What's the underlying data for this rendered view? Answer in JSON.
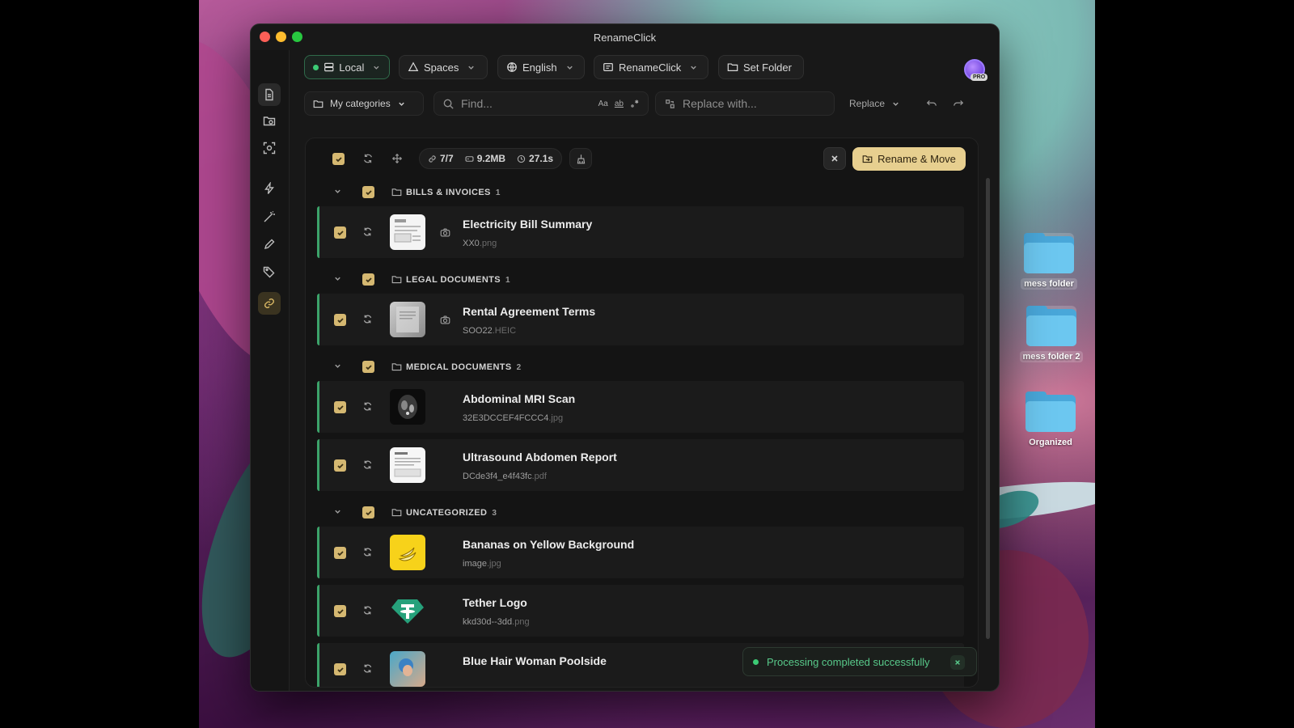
{
  "window": {
    "title": "RenameClick"
  },
  "toolbar": {
    "local": "Local",
    "spaces": "Spaces",
    "language": "English",
    "profile": "RenameClick",
    "set_folder": "Set Folder",
    "pro_badge": "PRO"
  },
  "search": {
    "categories": "My categories",
    "find_placeholder": "Find...",
    "case_label": "Aa",
    "word_label": "ab",
    "replace_placeholder": "Replace with...",
    "replace_mode": "Replace"
  },
  "stats": {
    "files": "7/7",
    "size": "9.2MB",
    "time": "27.1s"
  },
  "actions": {
    "rename_move": "Rename & Move"
  },
  "categories": [
    {
      "name": "BILLS & INVOICES",
      "count": "1"
    },
    {
      "name": "LEGAL DOCUMENTS",
      "count": "1"
    },
    {
      "name": "MEDICAL DOCUMENTS",
      "count": "2"
    },
    {
      "name": "UNCATEGORIZED",
      "count": "3"
    }
  ],
  "files": [
    {
      "title": "Electricity Bill Summary",
      "name": "XX0",
      "ext": ".png"
    },
    {
      "title": "Rental Agreement Terms",
      "name": "SOO22",
      "ext": ".HEIC"
    },
    {
      "title": "Abdominal MRI Scan",
      "name": "32E3DCCEF4FCCC4",
      "ext": ".jpg"
    },
    {
      "title": "Ultrasound Abdomen Report",
      "name": "DCde3f4_e4f43fc",
      "ext": ".pdf"
    },
    {
      "title": "Bananas on Yellow Background",
      "name": "image",
      "ext": ".jpg"
    },
    {
      "title": "Tether Logo",
      "name": "kkd30d--3dd",
      "ext": ".png"
    },
    {
      "title": "Blue Hair Woman Poolside",
      "name": "",
      "ext": ""
    }
  ],
  "toast": {
    "message": "Processing completed successfully"
  },
  "desktop": {
    "folders": [
      "mess folder",
      "mess folder 2",
      "Organized"
    ]
  },
  "colors": {
    "accent_gold": "#e7cf8f",
    "success_green": "#3ccb75",
    "checkbox": "#d5b871",
    "window_bg": "#181818"
  }
}
